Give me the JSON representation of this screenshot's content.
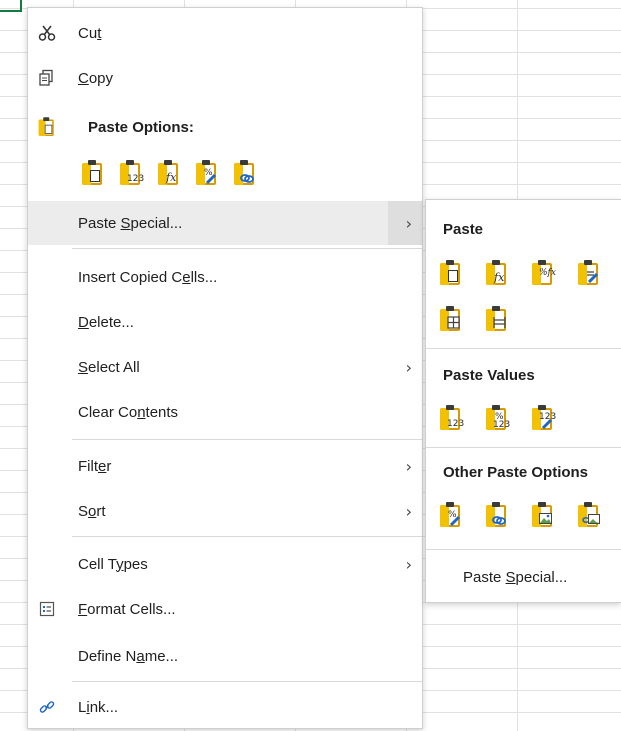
{
  "menu": {
    "cut": {
      "pre": "Cu",
      "ul": "t",
      "post": ""
    },
    "copy": {
      "pre": "",
      "ul": "C",
      "post": "opy"
    },
    "paste_options": "Paste Options:",
    "paste_special": {
      "pre": "Paste ",
      "ul": "S",
      "post": "pecial..."
    },
    "insert_copied_cells": {
      "pre": "Insert Copied C",
      "ul": "e",
      "post": "lls..."
    },
    "delete": {
      "pre": "",
      "ul": "D",
      "post": "elete..."
    },
    "select_all": {
      "pre": "",
      "ul": "S",
      "post": "elect All"
    },
    "clear_contents": {
      "pre": "Clear Co",
      "ul": "n",
      "post": "tents"
    },
    "filter": {
      "pre": "Filt",
      "ul": "e",
      "post": "r"
    },
    "sort": {
      "pre": "S",
      "ul": "o",
      "post": "rt"
    },
    "cell_types": {
      "pre": "Cell T",
      "ul": "y",
      "post": "pes"
    },
    "format_cells": {
      "pre": "",
      "ul": "F",
      "post": "ormat Cells..."
    },
    "define_name": {
      "pre": "Define N",
      "ul": "a",
      "post": "me..."
    },
    "link": {
      "pre": "L",
      "ul": "i",
      "post": "nk..."
    }
  },
  "submenu": {
    "paste": "Paste",
    "paste_values": "Paste Values",
    "other_paste_options": "Other Paste Options",
    "paste_special": {
      "pre": "Paste ",
      "ul": "S",
      "post": "pecial..."
    }
  },
  "icon_overlays": {
    "values": "123",
    "formula": "fx",
    "percent": "%",
    "percent_formula": "%fx"
  },
  "colors": {
    "accent_green": "#107c41",
    "clipboard_yellow": "#f2c200",
    "highlight": "#ececec"
  }
}
